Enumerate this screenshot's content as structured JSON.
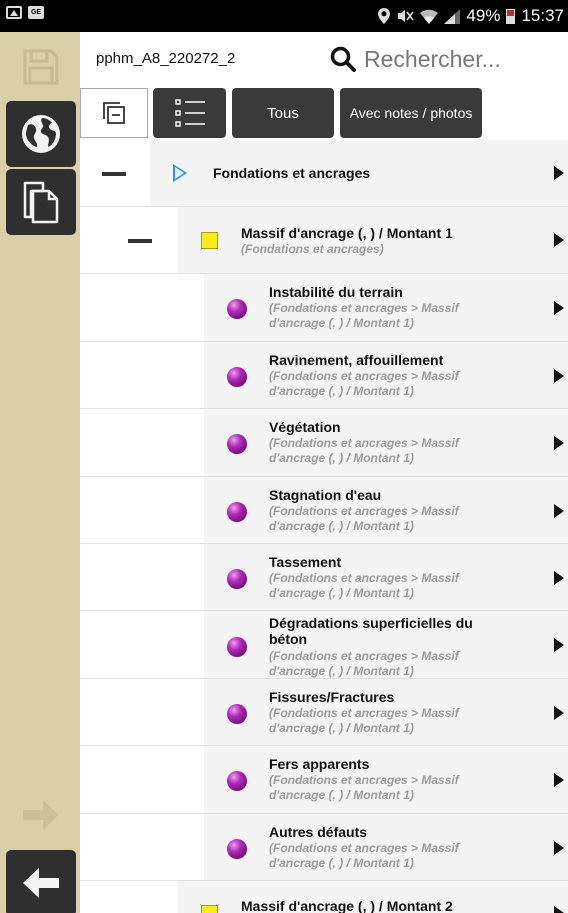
{
  "status_bar": {
    "battery_text": "49%",
    "time": "15:37",
    "icons": [
      "gallery-icon",
      "ge-icon",
      "location-icon",
      "mute-icon",
      "wifi-icon",
      "signal-icon",
      "battery-icon"
    ]
  },
  "sidebar": {
    "buttons": [
      "save-icon",
      "globe-icon",
      "copy-icon",
      "arrow-right-icon",
      "arrow-left-icon"
    ]
  },
  "header": {
    "project_name": "pphm_A8_220272_2",
    "search_placeholder": "Rechercher..."
  },
  "toolbar": {
    "collapse_icon": "collapse-icon",
    "list_icon": "list-icon",
    "all_label": "Tous",
    "notes_label": "Avec notes / photos"
  },
  "tree": {
    "root": {
      "title": "Fondations et ancrages"
    },
    "group1": {
      "title": "Massif d'ancrage (, ) / Montant 1",
      "path": "(Fondations et ancrages)"
    },
    "items": [
      {
        "title": "Instabilité du terrain",
        "path1": "(Fondations et ancrages > Massif",
        "path2": "d'ancrage (, ) / Montant 1)"
      },
      {
        "title": "Ravinement, affouillement",
        "path1": "(Fondations et ancrages > Massif",
        "path2": "d'ancrage (, ) / Montant 1)"
      },
      {
        "title": "Végétation",
        "path1": "(Fondations et ancrages > Massif",
        "path2": "d'ancrage (, ) / Montant 1)"
      },
      {
        "title": "Stagnation d'eau",
        "path1": "(Fondations et ancrages > Massif",
        "path2": "d'ancrage (, ) / Montant 1)"
      },
      {
        "title": "Tassement",
        "path1": "(Fondations et ancrages > Massif",
        "path2": "d'ancrage (, ) / Montant 1)"
      },
      {
        "title": "Dégradations superficielles du",
        "title2": "béton",
        "path1": "(Fondations et ancrages > Massif",
        "path2": "d'ancrage (, ) / Montant 1)"
      },
      {
        "title": "Fissures/Fractures",
        "path1": "(Fondations et ancrages > Massif",
        "path2": "d'ancrage (, ) / Montant 1)"
      },
      {
        "title": "Fers apparents",
        "path1": "(Fondations et ancrages > Massif",
        "path2": "d'ancrage (, ) / Montant 1)"
      },
      {
        "title": "Autres défauts",
        "path1": "(Fondations et ancrages > Massif",
        "path2": "d'ancrage (, ) / Montant 1)"
      }
    ],
    "group2": {
      "title": "Massif d'ancrage (, ) / Montant 2"
    }
  },
  "colors": {
    "sidebar_bg": "#d9cfa8",
    "dark_button": "#2f2f2f",
    "defect_dot": "#9b1fa6",
    "element_square": "#f6ec1e",
    "section_triangle": "#2196f3"
  }
}
